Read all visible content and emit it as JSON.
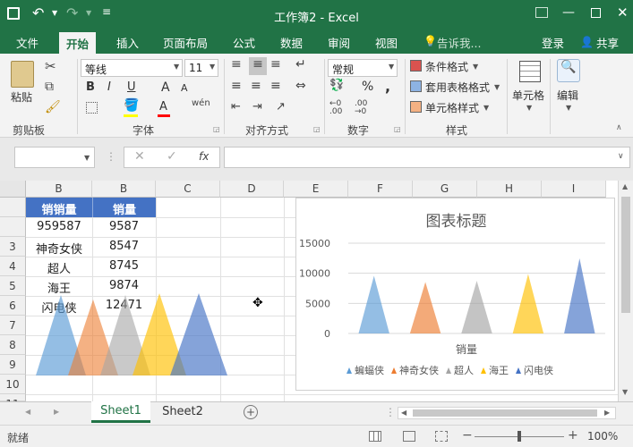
{
  "window": {
    "title": "工作簿2 - Excel"
  },
  "ribbon_tabs": [
    "文件",
    "开始",
    "插入",
    "页面布局",
    "公式",
    "数据",
    "审阅",
    "视图"
  ],
  "tell_me": "告诉我...",
  "account": {
    "login": "登录",
    "share": "共享"
  },
  "clipboard": {
    "paste": "粘贴",
    "group": "剪贴板"
  },
  "font": {
    "name": "等线",
    "size": "11",
    "group": "字体",
    "bold": "B",
    "italic": "I",
    "underline": "U",
    "grow": "A",
    "shrink": "A",
    "wen": "wén"
  },
  "alignment": {
    "group": "对齐方式"
  },
  "number": {
    "format": "常规",
    "group": "数字",
    "percent": "%",
    "comma": ","
  },
  "styles": {
    "conditional": "条件格式",
    "table": "套用表格格式",
    "cell": "单元格样式",
    "group": "样式"
  },
  "cells": {
    "label": "单元格"
  },
  "editing": {
    "label": "编辑"
  },
  "formula_bar": {
    "fx": "fx",
    "value": ""
  },
  "columns": [
    "B",
    "B",
    "C",
    "D",
    "E",
    "F",
    "G",
    "H",
    "I"
  ],
  "rows": [
    "3",
    "4",
    "5",
    "6",
    "7",
    "8",
    "9",
    "10",
    "11"
  ],
  "table": {
    "header": [
      "销销量",
      "销量"
    ],
    "data": [
      [
        "959587",
        "9587"
      ],
      [
        "神奇女侠",
        "8547"
      ],
      [
        "超人",
        "8745"
      ],
      [
        "海王",
        "9874"
      ],
      [
        "闪电侠",
        "12471"
      ]
    ]
  },
  "chart_data": {
    "type": "bar",
    "title": "图表标题",
    "xlabel": "销量",
    "ylabel": "",
    "ylim": [
      0,
      15000
    ],
    "yticks": [
      "15000",
      "10000",
      "5000",
      "0"
    ],
    "series": [
      {
        "name": "蝙蝠侠",
        "value": 9587,
        "color": "#5b9bd5"
      },
      {
        "name": "神奇女侠",
        "value": 8547,
        "color": "#ed7d31"
      },
      {
        "name": "超人",
        "value": 8745,
        "color": "#a5a5a5"
      },
      {
        "name": "海王",
        "value": 9874,
        "color": "#ffc000"
      },
      {
        "name": "闪电侠",
        "value": 12471,
        "color": "#4472c4"
      }
    ]
  },
  "sheets": [
    "Sheet1",
    "Sheet2"
  ],
  "status": {
    "ready": "就绪",
    "zoom": "100%"
  }
}
